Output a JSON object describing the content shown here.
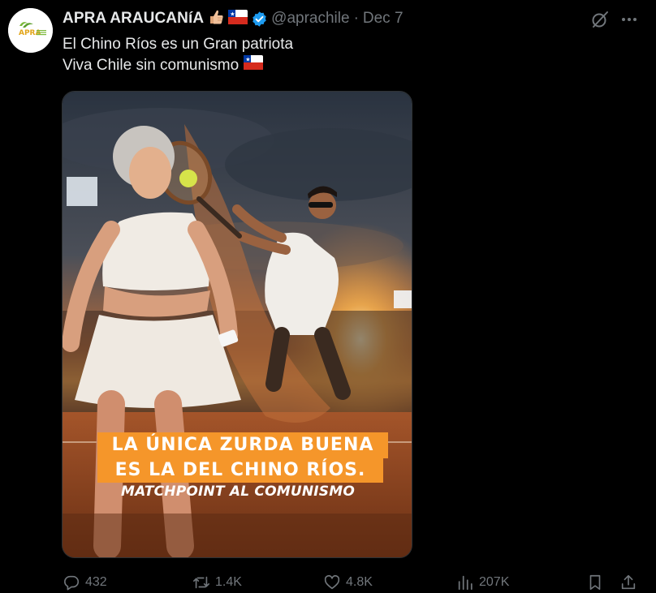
{
  "author": {
    "display_name": "APRA ARAUCANíA",
    "handle": "@aprachile",
    "separator": "·",
    "date": "Dec 7",
    "verified": true,
    "avatar_text": "APRA",
    "name_emojis": [
      "thumbs-up-emoji",
      "chile-flag-emoji"
    ]
  },
  "tweet": {
    "lines": [
      "El Chino Ríos es un Gran patriota",
      "Viva Chile sin comunismo"
    ],
    "line2_emoji": "chile-flag-emoji"
  },
  "media": {
    "caption_line1": "LA ÚNICA ZURDA BUENA",
    "caption_line2": "ES LA DEL CHINO RÍOS.",
    "caption_line3": "MATCHPOINT AL COMUNISMO"
  },
  "actions": {
    "replies": "432",
    "reposts": "1.4K",
    "likes": "4.8K",
    "views": "207K"
  },
  "colors": {
    "background": "#000000",
    "text": "#e7e9ea",
    "muted": "#71767b",
    "verified_blue": "#1d9bf0",
    "caption_orange": "#f5962a"
  }
}
